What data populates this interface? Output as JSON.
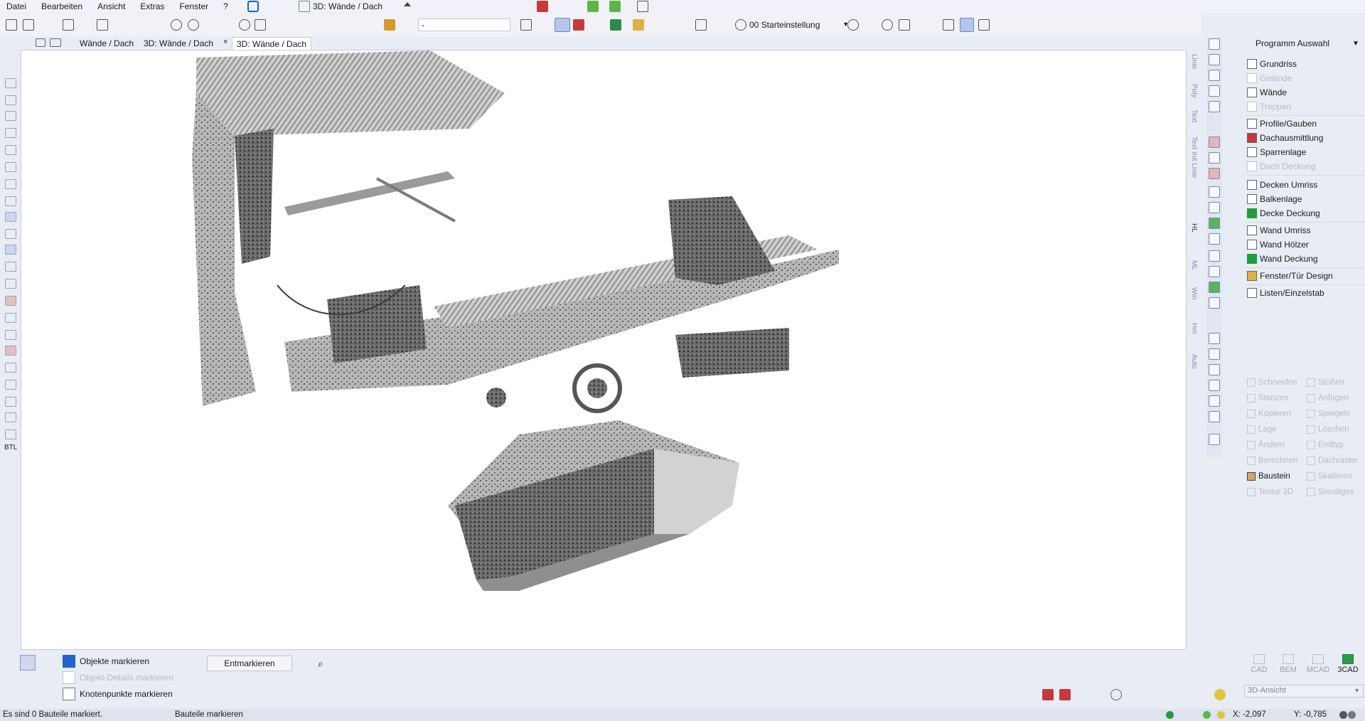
{
  "menu": {
    "items": [
      "Datei",
      "Bearbeiten",
      "Ansicht",
      "Extras",
      "Fenster",
      "?"
    ],
    "window_title": "3D: Wände / Dach"
  },
  "toolbar": {
    "layer_value": "-",
    "view_setting": "00 Starteinstellung"
  },
  "tabs": [
    "Wände / Dach",
    "3D: Wände / Dach",
    "3D: Wände / Dach"
  ],
  "left_toolbar": {
    "btl_label": "BTL"
  },
  "vertical_labels": [
    "Linie",
    "Poly",
    "Text",
    "Text mit Linie",
    "HL",
    "ML",
    "Win",
    "Hm",
    "Auto"
  ],
  "right_panel": {
    "header": "Programm Auswahl",
    "items": [
      {
        "label": "Grundriss",
        "enabled": true
      },
      {
        "label": "Gelände",
        "enabled": false
      },
      {
        "label": "Wände",
        "enabled": true
      },
      {
        "label": "Treppen",
        "enabled": false
      },
      {
        "label": "Profile/Gauben",
        "enabled": true
      },
      {
        "label": "Dachausmittlung",
        "enabled": true
      },
      {
        "label": "Sparrenlage",
        "enabled": true
      },
      {
        "label": "Dach Deckung",
        "enabled": false
      },
      {
        "label": "Decken Umriss",
        "enabled": true
      },
      {
        "label": "Balkenlage",
        "enabled": true
      },
      {
        "label": "Decke Deckung",
        "enabled": true
      },
      {
        "label": "Wand Umriss",
        "enabled": true
      },
      {
        "label": "Wand Hölzer",
        "enabled": true
      },
      {
        "label": "Wand Deckung",
        "enabled": true
      },
      {
        "label": "Fenster/Tür Design",
        "enabled": true
      },
      {
        "label": "Listen/Einzelstab",
        "enabled": true
      }
    ],
    "tools": [
      {
        "label": "Schneiden",
        "enabled": false
      },
      {
        "label": "Stoßen",
        "enabled": false
      },
      {
        "label": "Stanzen",
        "enabled": false
      },
      {
        "label": "Anfügen",
        "enabled": false
      },
      {
        "label": "Kopieren",
        "enabled": false
      },
      {
        "label": "Spiegeln",
        "enabled": false
      },
      {
        "label": "Lage",
        "enabled": false
      },
      {
        "label": "Löschen",
        "enabled": false
      },
      {
        "label": "Ändern",
        "enabled": false
      },
      {
        "label": "Endtyp",
        "enabled": false
      },
      {
        "label": "Berechnen",
        "enabled": false
      },
      {
        "label": "Dachraster",
        "enabled": false
      },
      {
        "label": "Baustein",
        "enabled": true
      },
      {
        "label": "Skalieren",
        "enabled": false
      },
      {
        "label": "Textur 3D",
        "enabled": false
      },
      {
        "label": "Sonstiges",
        "enabled": false
      }
    ]
  },
  "bottom_panel": {
    "objects_label": "Objekte markieren",
    "object_details_label": "Objekt-Details markieren",
    "nodes_label": "Knotenpunkte markieren",
    "unmark_button": "Entmarkieren"
  },
  "modes": [
    {
      "label": "CAD",
      "active": false
    },
    {
      "label": "BEM",
      "active": false
    },
    {
      "label": "MCAD",
      "active": false
    },
    {
      "label": "3CAD",
      "active": true
    }
  ],
  "view_select": "3D-Ansicht",
  "statusbar": {
    "message": "Es sind 0 Bauteile markiert.",
    "mode": "Bauteile markieren",
    "x": "X: -2,097",
    "y": "Y: -0,785"
  },
  "colors": {
    "accent": "#1f64c8",
    "status_green": "#1e9e3a",
    "background": "#e8ecf5"
  }
}
